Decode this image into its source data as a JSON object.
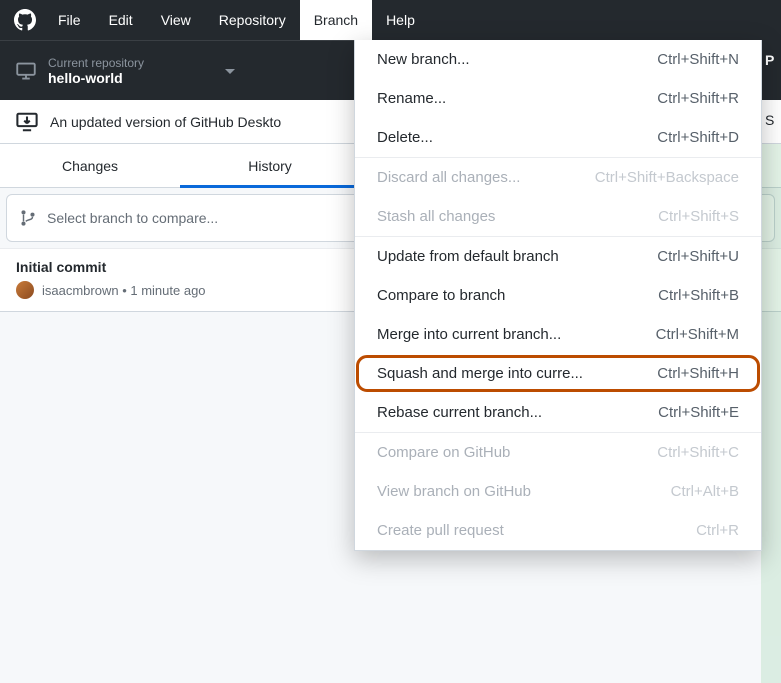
{
  "menubar": {
    "items": [
      "File",
      "Edit",
      "View",
      "Repository",
      "Branch",
      "Help"
    ],
    "active": "Branch"
  },
  "toolbar": {
    "repo": {
      "label": "Current repository",
      "value": "hello-world"
    },
    "right_clip": "P"
  },
  "banner": {
    "text": "An updated version of GitHub Deskto",
    "right_clip": "S"
  },
  "tabs": {
    "items": [
      "Changes",
      "History"
    ],
    "active": "History"
  },
  "branch_select": {
    "placeholder": "Select branch to compare..."
  },
  "commits": [
    {
      "title": "Initial commit",
      "author": "isaacmbrown",
      "time": "1 minute ago"
    }
  ],
  "dropdown": {
    "groups": [
      [
        {
          "label": "New branch...",
          "shortcut": "Ctrl+Shift+N",
          "disabled": false
        },
        {
          "label": "Rename...",
          "shortcut": "Ctrl+Shift+R",
          "disabled": false
        },
        {
          "label": "Delete...",
          "shortcut": "Ctrl+Shift+D",
          "disabled": false
        }
      ],
      [
        {
          "label": "Discard all changes...",
          "shortcut": "Ctrl+Shift+Backspace",
          "disabled": true
        },
        {
          "label": "Stash all changes",
          "shortcut": "Ctrl+Shift+S",
          "disabled": true
        }
      ],
      [
        {
          "label": "Update from default branch",
          "shortcut": "Ctrl+Shift+U",
          "disabled": false
        },
        {
          "label": "Compare to branch",
          "shortcut": "Ctrl+Shift+B",
          "disabled": false
        },
        {
          "label": "Merge into current branch...",
          "shortcut": "Ctrl+Shift+M",
          "disabled": false
        },
        {
          "label": "Squash and merge into curre...",
          "shortcut": "Ctrl+Shift+H",
          "disabled": false,
          "highlighted": true
        },
        {
          "label": "Rebase current branch...",
          "shortcut": "Ctrl+Shift+E",
          "disabled": false
        }
      ],
      [
        {
          "label": "Compare on GitHub",
          "shortcut": "Ctrl+Shift+C",
          "disabled": true
        },
        {
          "label": "View branch on GitHub",
          "shortcut": "Ctrl+Alt+B",
          "disabled": true
        },
        {
          "label": "Create pull request",
          "shortcut": "Ctrl+R",
          "disabled": true
        }
      ]
    ]
  }
}
